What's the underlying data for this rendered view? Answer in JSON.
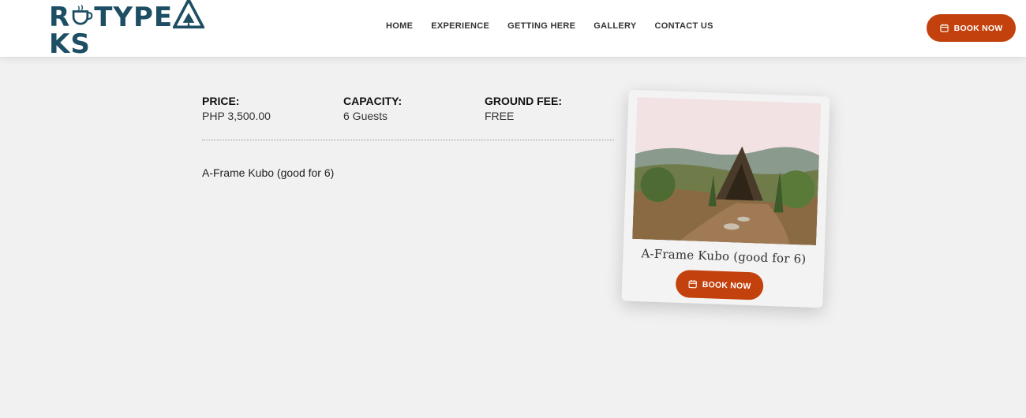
{
  "header": {
    "logo_alt": "ROTYPEAKS",
    "nav": [
      "HOME",
      "EXPERIENCE",
      "GETTING HERE",
      "GALLERY",
      "CONTACT US"
    ],
    "book_label": "BOOK NOW"
  },
  "details": {
    "price_label": "PRICE:",
    "price_value": "PHP 3,500.00",
    "capacity_label": "CAPACITY:",
    "capacity_value": "6 Guests",
    "fee_label": "GROUND FEE:",
    "fee_value": "FREE",
    "description": "A-Frame Kubo (good for 6)"
  },
  "card": {
    "caption": "A-Frame Kubo (good for 6)",
    "book_label": "BOOK NOW"
  },
  "colors": {
    "brand": "#1d4e63",
    "accent": "#c2410c",
    "background": "#f1f1f1"
  },
  "icons": [
    "calendar-icon",
    "mountain-logo-icon",
    "cup-logo-icon"
  ]
}
